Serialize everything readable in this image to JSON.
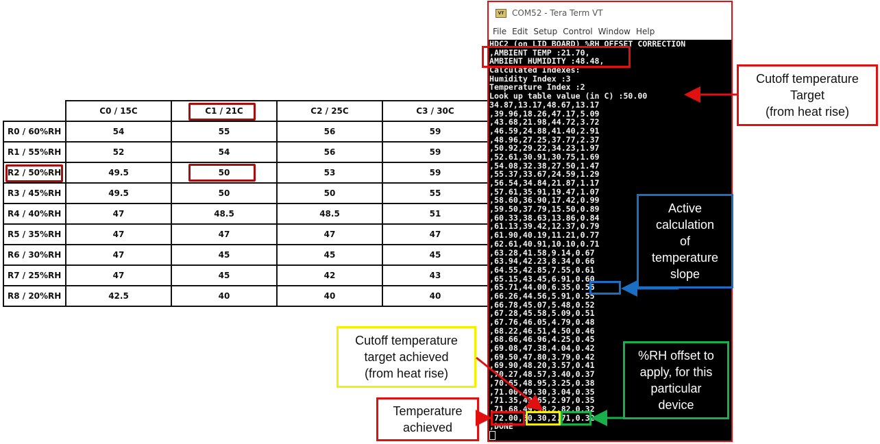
{
  "lookup_table": {
    "columns": [
      "C0  / 15C",
      "C1 / 21C",
      "C2 / 25C",
      "C3 / 30C"
    ],
    "rows": [
      {
        "label": "R0 / 60%RH",
        "values": [
          "54",
          "55",
          "56",
          "59"
        ]
      },
      {
        "label": "R1 / 55%RH",
        "values": [
          "52",
          "54",
          "56",
          "59"
        ]
      },
      {
        "label": "R2 / 50%RH",
        "values": [
          "49.5",
          "50",
          "53",
          "59"
        ]
      },
      {
        "label": "R3 / 45%RH",
        "values": [
          "49.5",
          "50",
          "50",
          "55"
        ]
      },
      {
        "label": "R4 / 40%RH",
        "values": [
          "47",
          "48.5",
          "48.5",
          "51"
        ]
      },
      {
        "label": "R5 / 35%RH",
        "values": [
          "47",
          "47",
          "47",
          "47"
        ]
      },
      {
        "label": "R6 / 30%RH",
        "values": [
          "47",
          "45",
          "45",
          "45"
        ]
      },
      {
        "label": "R7 / 25%RH",
        "values": [
          "47",
          "45",
          "42",
          "43"
        ]
      },
      {
        "label": "R8 / 20%RH",
        "values": [
          "42.5",
          "40",
          "40",
          "40"
        ]
      }
    ],
    "highlighted_column": "C1 / 21C",
    "highlighted_row": "R2 / 50%RH",
    "highlighted_value": "50"
  },
  "terminal": {
    "app_icon": "VT",
    "title": "COM52 - Tera Term VT",
    "menu": [
      "File",
      "Edit",
      "Setup",
      "Control",
      "Window",
      "Help"
    ],
    "lines": [
      "HDC2 (on LID BOARD) %RH OFFSET CORRECTION",
      ",AMBIENT TEMP :21.70,",
      "AMBIENT HUMIDITY :48.48,",
      "Calculated Indexes:",
      "Humidity Index :3",
      "Temperature Index :2",
      "Look up table value (in C) :50.00",
      "34.87,13.17,48.67,13.17",
      ",39.96,18.26,47.17,5.09",
      ",43.68,21.98,44.72,3.72",
      ",46.59,24.88,41.40,2.91",
      ",48.96,27.25,37.77,2.37",
      ",50.92,29.22,34.23,1.97",
      ",52.61,30.91,30.75,1.69",
      ",54.08,32.38,27.50,1.47",
      ",55.37,33.67,24.59,1.29",
      ",56.54,34.84,21.87,1.17",
      ",57.61,35.91,19.47,1.07",
      ",58.60,36.90,17.42,0.99",
      ",59.50,37.79,15.50,0.89",
      ",60.33,38.63,13.86,0.84",
      ",61.13,39.42,12.37,0.79",
      ",61.90,40.19,11.21,0.77",
      ",62.61,40.91,10.10,0.71",
      ",63.28,41.58,9.14,0.67",
      ",63.94,42.23,8.34,0.66",
      ",64.55,42.85,7.55,0.61",
      ",65.15,43.45,6.91,0.60",
      ",65.71,44.00,6.35,0.56",
      ",66.26,44.56,5.91,0.55",
      ",66.78,45.07,5.48,0.52",
      ",67.28,45.58,5.09,0.51",
      ",67.76,46.05,4.79,0.48",
      ",68.22,46.51,4.50,0.46",
      ",68.66,46.96,4.25,0.45",
      ",69.08,47.38,4.04,0.42",
      ",69.50,47.80,3.79,0.42",
      ",69.90,48.20,3.57,0.41",
      ",70.27,48.57,3.40,0.37",
      ",70.65,48.95,3.25,0.38",
      ",71.00,49.30,3.04,0.35",
      ",71.35,49.65,2.97,0.35",
      ",71.68,49.98,2.82,0.32",
      ",72.00,50.30,2.71,0.32",
      ",DONE"
    ]
  },
  "annotations": {
    "cutoff_target": "Cutoff temperature\nTarget\n(from heat rise)",
    "active_slope": "Active\ncalculation\nof\ntemperature\nslope",
    "cutoff_achieved": "Cutoff temperature\ntarget achieved\n(from heat rise)",
    "rh_offset": "%RH offset to\napply, for this\nparticular\ndevice",
    "temperature_achieved": "Temperature\nachieved"
  },
  "colors": {
    "red": "#e01010",
    "dark_red": "#a80d0d",
    "blue": "#1a6fc4",
    "yellow": "#f5f000",
    "green": "#18b04a"
  }
}
